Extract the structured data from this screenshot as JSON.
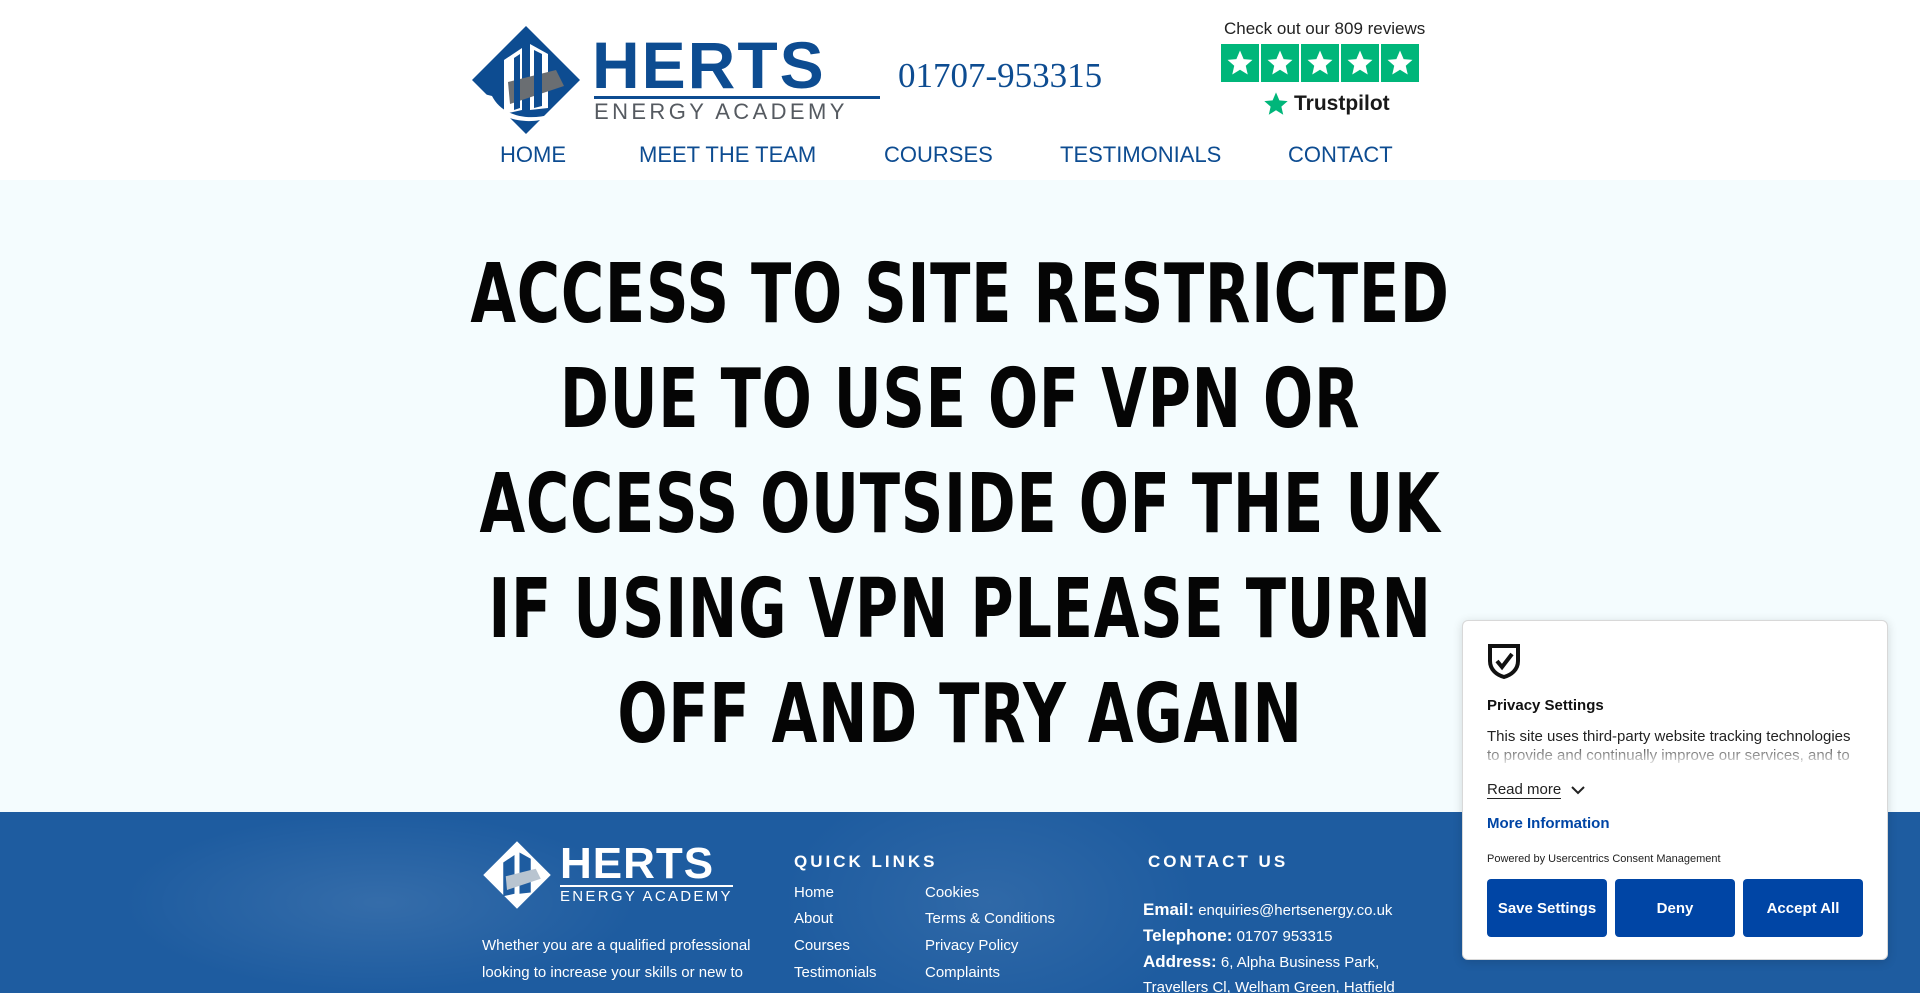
{
  "brand": {
    "name": "HERTS",
    "tagline": "ENERGY ACADEMY",
    "primary_color": "#0d4c91"
  },
  "header": {
    "phone": "01707-953315",
    "trustpilot": {
      "reviews_text": "Check out our 809 reviews",
      "rating_stars": 5,
      "logo_text": "Trustpilot",
      "star_color": "#00b67a"
    }
  },
  "nav": {
    "items": [
      {
        "label": "HOME"
      },
      {
        "label": "MEET THE TEAM"
      },
      {
        "label": "COURSES"
      },
      {
        "label": "TESTIMONIALS"
      },
      {
        "label": "CONTACT"
      }
    ]
  },
  "hero": {
    "lines": [
      "ACCESS TO SITE RESTRICTED",
      "DUE TO USE OF VPN OR",
      "ACCESS OUTSIDE OF THE UK",
      "IF USING VPN PLEASE TURN",
      "OFF AND TRY AGAIN"
    ]
  },
  "footer": {
    "about_text": "Whether you are a qualified professional looking to increase your skills or new to",
    "quick_links": {
      "heading": "QUICK LINKS",
      "col1": [
        "Home",
        "About",
        "Courses",
        "Testimonials"
      ],
      "col2": [
        "Cookies",
        "Terms & Conditions",
        "Privacy Policy",
        "Complaints"
      ]
    },
    "contact": {
      "heading": "CONTACT US",
      "email_label": "Email:",
      "email": "enquiries@hertsenergy.co.uk",
      "telephone_label": "Telephone:",
      "telephone": "01707 953315",
      "address_label": "Address:",
      "address_line1": "6, Alpha Business Park,",
      "address_line2": "Travellers Cl, Welham Green, Hatfield"
    },
    "background_color": "#1e5ca0"
  },
  "privacy": {
    "title": "Privacy Settings",
    "text": "This site uses third-party website tracking technologies to provide and continually improve our services, and to",
    "read_more": "Read more",
    "more_information": "More Information",
    "powered_by": "Powered by Usercentrics Consent Management",
    "buttons": {
      "save": "Save Settings",
      "deny": "Deny",
      "accept": "Accept All"
    },
    "button_color": "#0045a5"
  }
}
